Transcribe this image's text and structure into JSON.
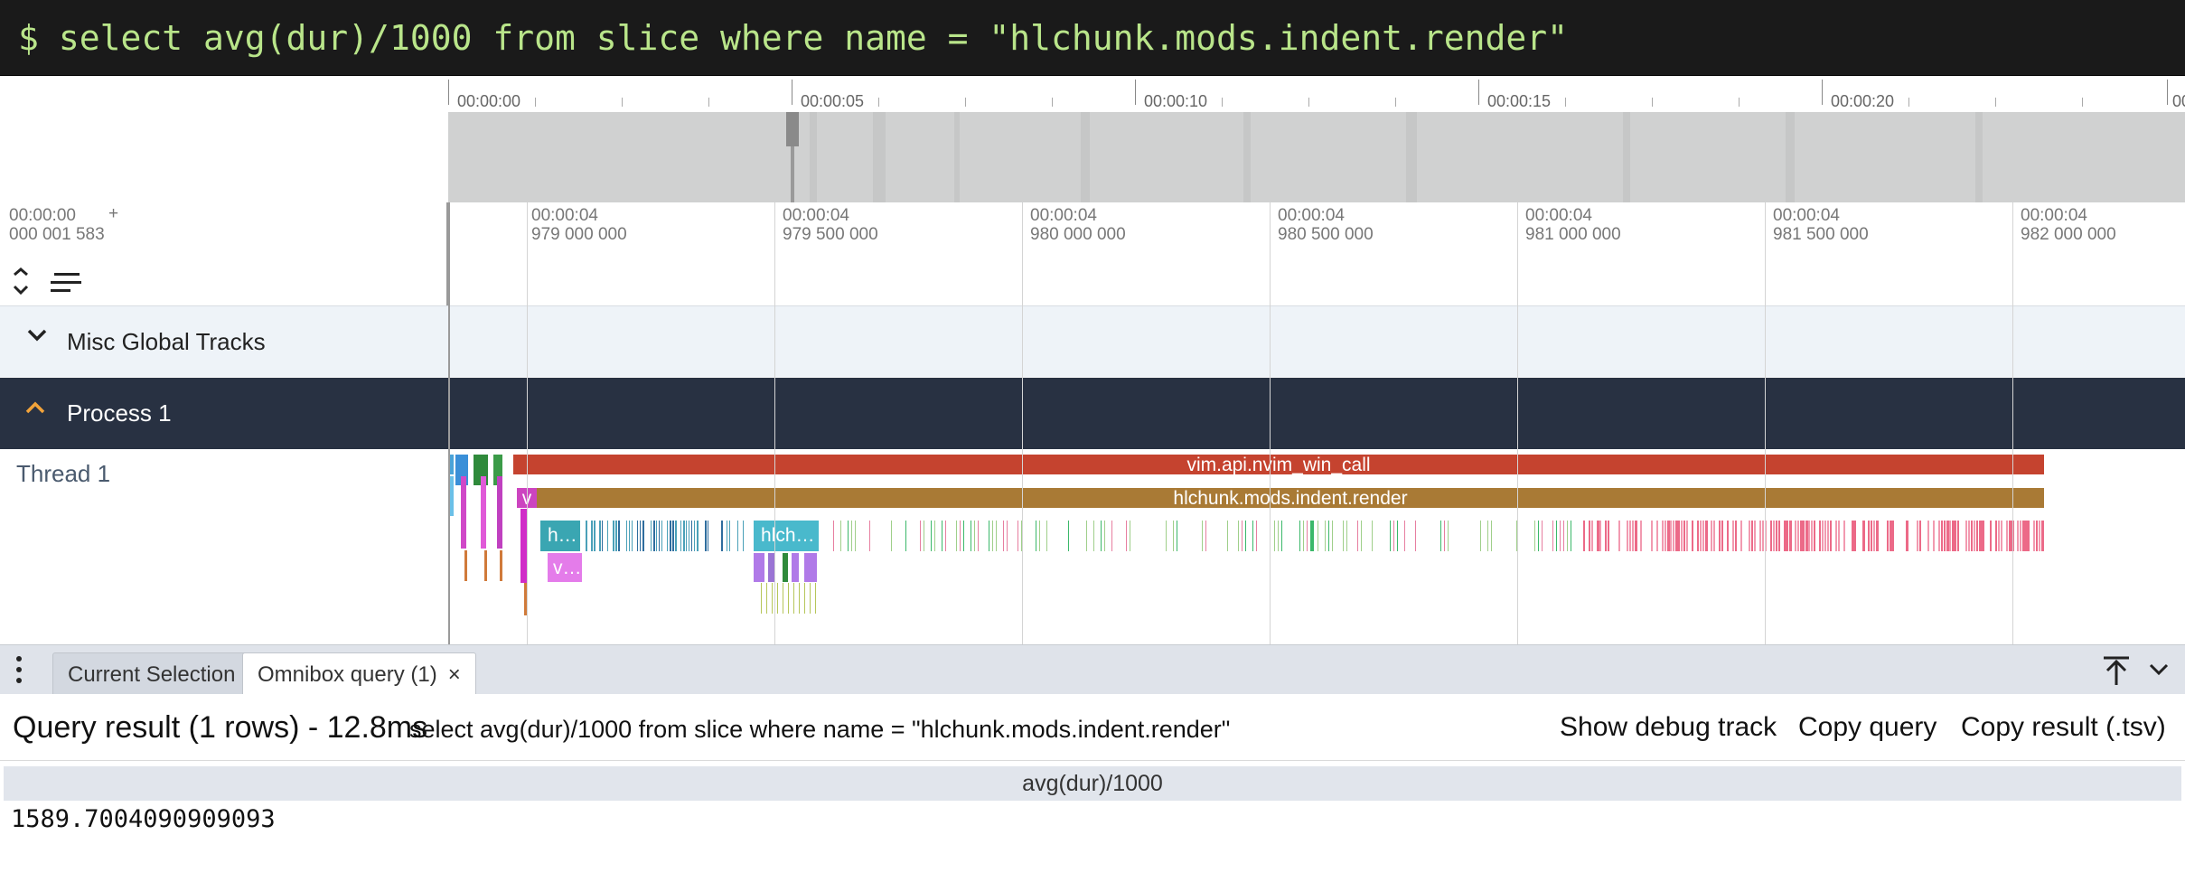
{
  "omnibox": {
    "prompt": "$",
    "query": "select avg(dur)/1000 from slice where name = \"hlchunk.mods.indent.render\""
  },
  "overview": {
    "ticks": [
      "00:00:00",
      "00:00:05",
      "00:00:10",
      "00:00:15",
      "00:00:20",
      "00"
    ]
  },
  "timeline": {
    "offset_line1": "00:00:00",
    "offset_line2": "000 001 583",
    "offset_plus": "+",
    "ticks": [
      {
        "l1": "00:00:04",
        "l2": "979 000 000"
      },
      {
        "l1": "00:00:04",
        "l2": "979 500 000"
      },
      {
        "l1": "00:00:04",
        "l2": "980 000 000"
      },
      {
        "l1": "00:00:04",
        "l2": "980 500 000"
      },
      {
        "l1": "00:00:04",
        "l2": "981 000 000"
      },
      {
        "l1": "00:00:04",
        "l2": "981 500 000"
      },
      {
        "l1": "00:00:04",
        "l2": "982 000 000"
      }
    ]
  },
  "tracks": {
    "misc": {
      "label": "Misc Global Tracks",
      "icon": "chevron-down-icon"
    },
    "process": {
      "label": "Process 1",
      "icon": "chevron-up-icon",
      "icon_color": "#f2a33a"
    },
    "thread": {
      "label": "Thread 1"
    }
  },
  "slices": {
    "win_call": {
      "label": "vim.api.nvim_win_call",
      "color": "#c5432f"
    },
    "render": {
      "label": "hlchunk.mods.indent.render",
      "color": "#a97a35"
    },
    "v_small": {
      "label": "v",
      "color": "#cc44c0"
    },
    "h_small": {
      "label": "h…",
      "color": "#3aa6b2"
    },
    "hlch": {
      "label": "hlch…",
      "color": "#49b9cc"
    },
    "v_dots": {
      "label": "v…",
      "color": "#e47cea"
    }
  },
  "bottom_panel": {
    "tabs": [
      {
        "label": "Current Selection"
      },
      {
        "label": "Omnibox query (1)",
        "close": "×"
      }
    ],
    "query_result_title": "Query result (1 rows) - 12.8ms",
    "query_sql": "select avg(dur)/1000 from slice where name = \"hlchunk.mods.indent.render\"",
    "buttons": {
      "debug": "Show debug track",
      "copy_query": "Copy query",
      "copy_result": "Copy result (.tsv)"
    },
    "table": {
      "columns": [
        "avg(dur)/1000"
      ],
      "rows": [
        [
          "1589.7004090909093"
        ]
      ]
    }
  }
}
